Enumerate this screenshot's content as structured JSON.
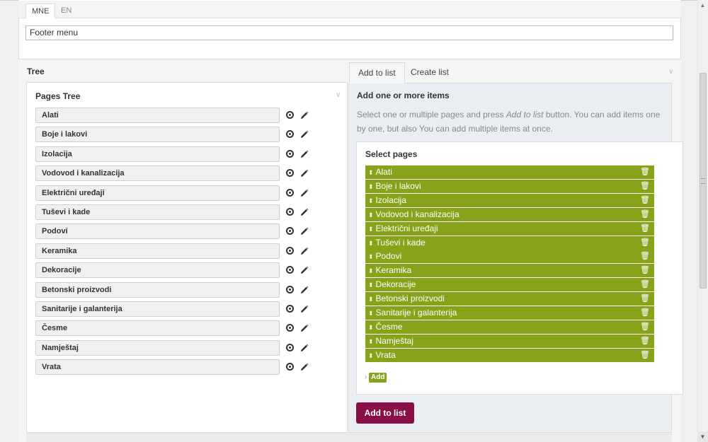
{
  "languages": {
    "active": "MNE",
    "other": "EN"
  },
  "menu_name": {
    "value": "Footer menu"
  },
  "tree_section": {
    "title": "Tree",
    "pages_tree_title": "Pages Tree"
  },
  "pages_tree": [
    "Alati",
    "Boje i lakovi",
    "Izolacija",
    "Vodovod i kanalizacija",
    "Električni uređaji",
    "Tuševi i kade",
    "Podovi",
    "Keramika",
    "Dekoracije",
    "Betonski proizvodi",
    "Sanitarije i galanterija",
    "Česme",
    "Namještaj",
    "Vrata"
  ],
  "tabs": {
    "add": "Add to list",
    "create": "Create list"
  },
  "add_pane": {
    "title": "Add one or more items",
    "desc_1": "Select one or multiple pages and press ",
    "desc_em": "Add to list",
    "desc_2": " button. You can add items one by one, but also You can add multiple items at once.",
    "select_title": "Select pages",
    "add_link": "Add",
    "add_button": "Add to list"
  },
  "selected_pages": [
    "Alati",
    "Boje i lakovi",
    "Izolacija",
    "Vodovod i kanalizacija",
    "Električni uređaji",
    "Tuševi i kade",
    "Podovi",
    "Keramika",
    "Dekoracije",
    "Betonski proizvodi",
    "Sanitarije i galanterija",
    "Česme",
    "Namještaj",
    "Vrata"
  ],
  "colors": {
    "accent_green": "#86a31a",
    "primary_button": "#8a0f47"
  },
  "icons": {
    "remove": "remove-circle-icon",
    "edit": "pencil-icon",
    "reorder": "sort-arrows-icon",
    "delete": "trash-icon"
  }
}
